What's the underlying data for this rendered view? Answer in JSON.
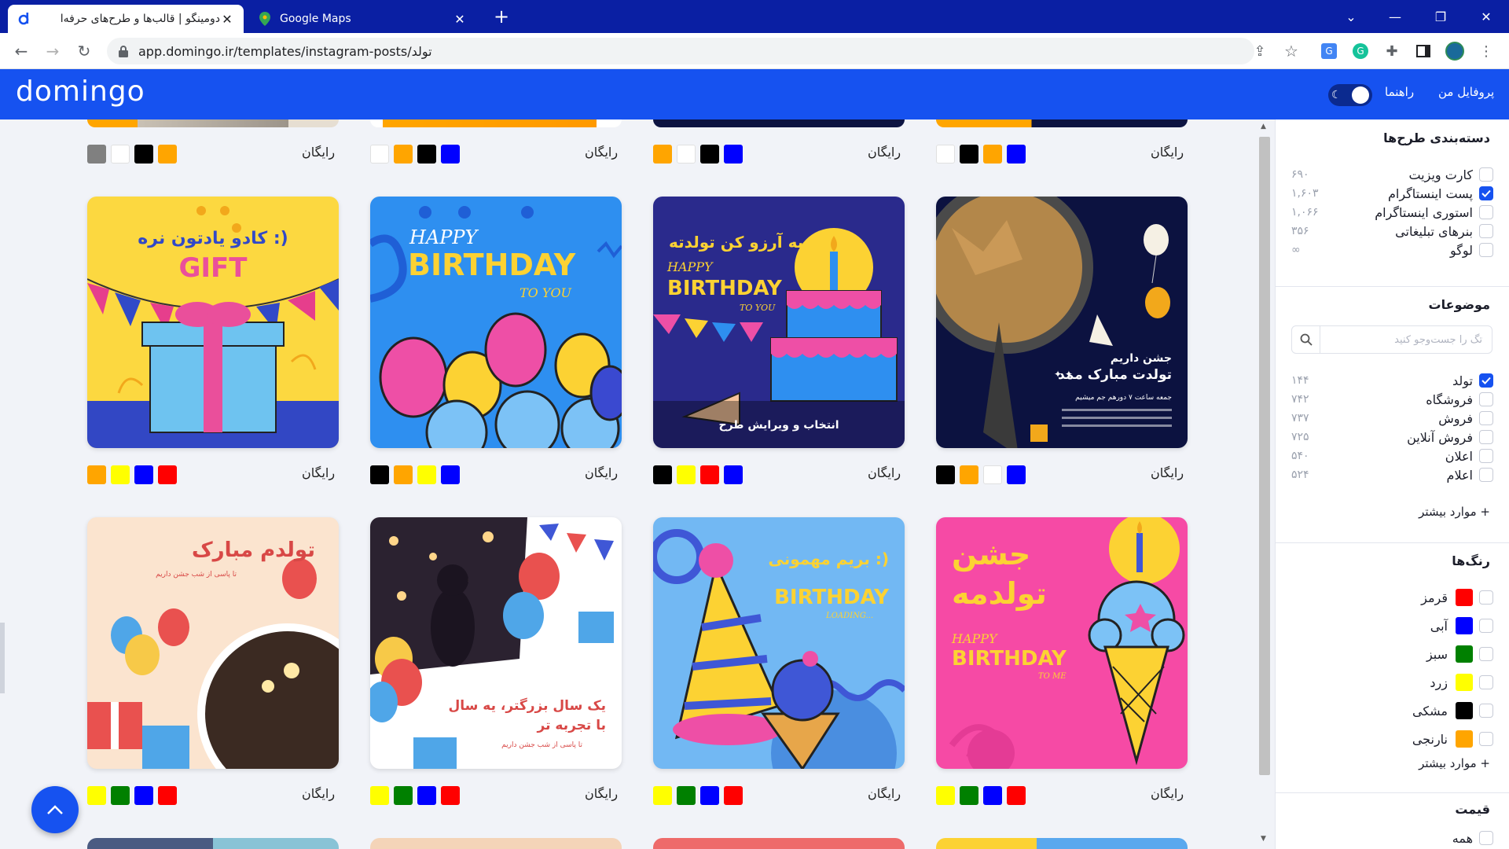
{
  "browser": {
    "active_tab_title": "دومینگو | قالب‌ها و طرح‌های حرفه‌ا",
    "other_tab_title": "Google Maps",
    "url": "app.domingo.ir/templates/instagram-posts/تولد"
  },
  "app": {
    "logo": "domingo",
    "nav_profile": "پروفایل من",
    "nav_guide": "راهنما"
  },
  "sidebar": {
    "categories_title": "دسته‌بندی طرح‌ها",
    "categories": [
      {
        "label": "کارت ویزیت",
        "count": "۶۹۰",
        "checked": false
      },
      {
        "label": "پست اینستاگرام",
        "count": "۱,۶۰۳",
        "checked": true
      },
      {
        "label": "استوری اینستاگرام",
        "count": "۱,۰۶۶",
        "checked": false
      },
      {
        "label": "بنرهای تبلیغاتی",
        "count": "۳۵۶",
        "checked": false
      },
      {
        "label": "لوگو",
        "count": "∞",
        "checked": false
      }
    ],
    "topics_title": "موضوعات",
    "topics_search_placeholder": "تگ را جست‌وجو کنید",
    "topics": [
      {
        "label": "تولد",
        "count": "۱۴۴",
        "checked": true
      },
      {
        "label": "فروشگاه",
        "count": "۷۴۲",
        "checked": false
      },
      {
        "label": "فروش",
        "count": "۷۳۷",
        "checked": false
      },
      {
        "label": "فروش آنلاین",
        "count": "۷۲۵",
        "checked": false
      },
      {
        "label": "اعلان",
        "count": "۵۴۰",
        "checked": false
      },
      {
        "label": "اعلام",
        "count": "۵۲۴",
        "checked": false
      }
    ],
    "topics_more": "+ موارد بیشتر",
    "colors_title": "رنگ‌ها",
    "colors": [
      {
        "label": "قرمز",
        "hex": "#ff0000"
      },
      {
        "label": "آبی",
        "hex": "#0000ff"
      },
      {
        "label": "سبز",
        "hex": "#008000"
      },
      {
        "label": "زرد",
        "hex": "#ffff00"
      },
      {
        "label": "مشکی",
        "hex": "#000000"
      },
      {
        "label": "نارنجی",
        "hex": "#ffa500"
      }
    ],
    "colors_more": "+ موارد بیشتر",
    "price_title": "قیمت",
    "price_all": "همه"
  },
  "grid": {
    "price_label": "رایگان",
    "hover_label": "انتخاب و ویرایش طرح",
    "top_row_colors": [
      [
        "#808080",
        "#ffffff",
        "#000000",
        "#ffa500"
      ],
      [
        "#ffffff",
        "#ffa500",
        "#000000",
        "#0000ff"
      ],
      [
        "#ffa500",
        "#ffffff",
        "#000000",
        "#0000ff"
      ],
      [
        "#ffffff",
        "#000000",
        "#ffa500",
        "#0000ff"
      ]
    ],
    "row1": [
      {
        "title": "کادو یادتون نره :)",
        "subtitle": "GIFT",
        "colors": [
          "#ffa500",
          "#ffff00",
          "#0000ff",
          "#ff0000"
        ]
      },
      {
        "title": "HAPPY",
        "subtitle": "BIRTHDAY",
        "tag": "TO YOU",
        "colors": [
          "#000000",
          "#ffa500",
          "#ffff00",
          "#0000ff"
        ]
      },
      {
        "title": "یه آرزو کن تولدته",
        "subtitle": "BIRTHDAY",
        "small": "HAPPY",
        "tag": "TO YOU",
        "colors": [
          "#000000",
          "#ffff00",
          "#ff0000",
          "#0000ff"
        ]
      },
      {
        "title": "جشن داریم",
        "subtitle": "تولدت مبارک ممد",
        "note": "جمعه ساعت ۷ دورهم جم میشیم",
        "colors": [
          "#000000",
          "#ffa500",
          "#ffffff",
          "#0000ff"
        ]
      }
    ],
    "row2": [
      {
        "title": "تولدم مبارک",
        "note": "تا پاسی از شب جشن داریم",
        "colors": [
          "#ffff00",
          "#008000",
          "#0000ff",
          "#ff0000"
        ]
      },
      {
        "title": "یک سال بزرگتر، یه سال",
        "subtitle": "با تجربه تر",
        "note": "تا پاسی از شب جشن داریم",
        "colors": [
          "#ffff00",
          "#008000",
          "#0000ff",
          "#ff0000"
        ]
      },
      {
        "title": "بریم مهمونی :)",
        "subtitle": "BIRTHDAY",
        "tag": "LOADING...",
        "colors": [
          "#ffff00",
          "#008000",
          "#0000ff",
          "#ff0000"
        ]
      },
      {
        "title": "جشن",
        "subtitle": "تولدمه",
        "small": "HAPPY",
        "big": "BIRTHDAY",
        "tag": "TO ME",
        "colors": [
          "#ffff00",
          "#008000",
          "#0000ff",
          "#ff0000"
        ]
      }
    ]
  }
}
